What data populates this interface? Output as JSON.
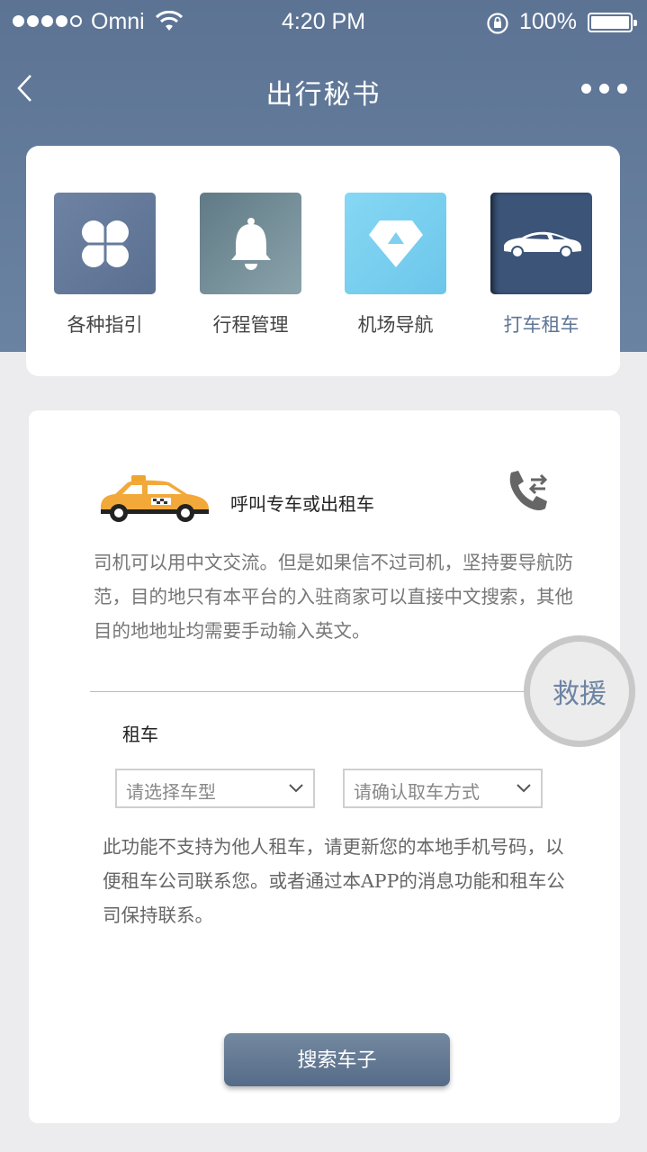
{
  "status_bar": {
    "carrier": "Omni",
    "time": "4:20 PM",
    "battery": "100%"
  },
  "nav": {
    "title": "出行秘书"
  },
  "features": [
    {
      "label": "各种指引",
      "icon": "clover-icon"
    },
    {
      "label": "行程管理",
      "icon": "bell-icon"
    },
    {
      "label": "机场导航",
      "icon": "diamond-icon"
    },
    {
      "label": "打车租车",
      "icon": "car-icon",
      "active": true
    }
  ],
  "main": {
    "call_title": "呼叫专车或出租车",
    "description": "司机可以用中文交流。但是如果信不过司机，坚持要导航防范，目的地只有本平台的入驻商家可以直接中文搜索，其他目的地地址均需要手动输入英文。",
    "rescue_label": "救援",
    "rental_label": "租车",
    "car_type_select": "请选择车型",
    "pickup_select": "请确认取车方式",
    "note": "此功能不支持为他人租车，请更新您的本地手机号码，以便租车公司联系您。或者通过本APP的消息功能和租车公司保持联系。",
    "search_button": "搜索车子"
  },
  "colors": {
    "header": "#5c7394",
    "accent": "#6d84a3",
    "button": "#5f7493"
  }
}
